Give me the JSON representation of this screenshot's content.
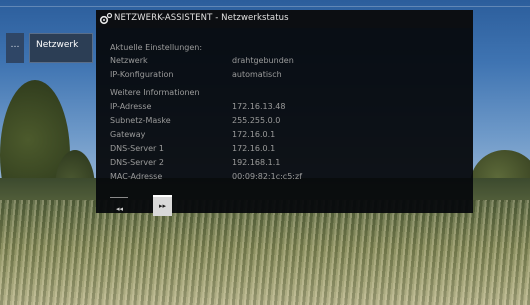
{
  "left_menu": {
    "small_tab_label": "…",
    "network_tab_label": "Netzwerk"
  },
  "dialog": {
    "title": "NETZWERK-ASSISTENT - Netzwerkstatus",
    "current_settings": {
      "heading": "Aktuelle Einstellungen:",
      "rows": [
        {
          "label": "Netzwerk",
          "value": "drahtgebunden"
        },
        {
          "label": "IP-Konfiguration",
          "value": "automatisch"
        }
      ]
    },
    "more_info": {
      "heading": "Weitere Informationen",
      "rows": [
        {
          "label": "IP-Adresse",
          "value": "172.16.13.48"
        },
        {
          "label": "Subnetz-Maske",
          "value": "255.255.0.0"
        },
        {
          "label": "Gateway",
          "value": "172.16.0.1"
        },
        {
          "label": "DNS-Server 1",
          "value": "172.16.0.1"
        },
        {
          "label": "DNS-Server 2",
          "value": "192.168.1.1"
        },
        {
          "label": "MAC-Adresse",
          "value": "00:09:82:1c:c5:zf"
        }
      ]
    },
    "buttons": {
      "rewind": "◂◂",
      "forward": "▸▸"
    }
  }
}
